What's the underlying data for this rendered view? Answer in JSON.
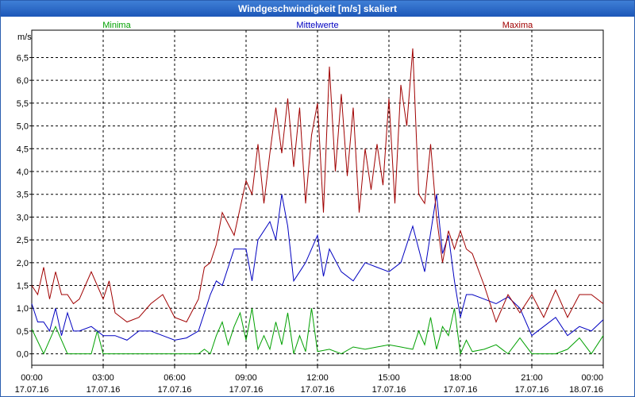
{
  "window": {
    "title": "Windgeschwindigkeit [m/s] skaliert"
  },
  "chart_data": {
    "type": "line",
    "title": "Windgeschwindigkeit [m/s] skaliert",
    "ylabel": "m/s",
    "xlabel": "",
    "ylim": [
      -0.25,
      7.1
    ],
    "y_ticks": [
      "0,0",
      "0,5",
      "1,0",
      "1,5",
      "2,0",
      "2,5",
      "3,0",
      "3,5",
      "4,0",
      "4,5",
      "5,0",
      "5,5",
      "6,0",
      "6,5"
    ],
    "y_tick_values": [
      0,
      0.5,
      1,
      1.5,
      2,
      2.5,
      3,
      3.5,
      4,
      4.5,
      5,
      5.5,
      6,
      6.5
    ],
    "x_ticks": [
      {
        "time": "00:00",
        "date": "17.07.16"
      },
      {
        "time": "03:00",
        "date": "17.07.16"
      },
      {
        "time": "06:00",
        "date": "17.07.16"
      },
      {
        "time": "09:00",
        "date": "17.07.16"
      },
      {
        "time": "12:00",
        "date": "17.07.16"
      },
      {
        "time": "15:00",
        "date": "17.07.16"
      },
      {
        "time": "18:00",
        "date": "17.07.16"
      },
      {
        "time": "21:00",
        "date": "17.07.16"
      },
      {
        "time": "00:00",
        "date": "18.07.16"
      }
    ],
    "x_tick_hours": [
      0,
      3,
      6,
      9,
      12,
      15,
      18,
      21,
      24
    ],
    "xlim_hours": [
      0,
      24
    ],
    "grid": true,
    "series": [
      {
        "name": "Minima",
        "color": "#00a000",
        "x_hours": [
          0,
          0.5,
          1,
          1.5,
          2,
          2.5,
          2.75,
          3,
          3.5,
          4,
          4.5,
          5,
          5.5,
          6,
          6.5,
          7,
          7.25,
          7.5,
          7.75,
          8,
          8.25,
          8.5,
          8.75,
          9,
          9.25,
          9.5,
          9.75,
          10,
          10.25,
          10.5,
          10.75,
          11,
          11.25,
          11.5,
          11.75,
          12,
          12.5,
          13,
          13.5,
          14,
          14.5,
          15,
          15.5,
          16,
          16.25,
          16.5,
          16.75,
          17,
          17.25,
          17.5,
          17.75,
          18,
          18.25,
          18.5,
          19,
          19.5,
          20,
          20.5,
          21,
          21.5,
          22,
          22.5,
          23,
          23.5,
          24
        ],
        "values": [
          0.55,
          0.0,
          0.6,
          0.0,
          0.0,
          0.0,
          0.5,
          0.0,
          0.0,
          0.0,
          0.0,
          0.0,
          0.0,
          0.0,
          0.0,
          0.0,
          0.1,
          0.0,
          0.4,
          0.7,
          0.2,
          0.6,
          0.9,
          0.3,
          1.0,
          0.1,
          0.4,
          0.1,
          0.7,
          0.2,
          0.9,
          0.0,
          0.4,
          0.05,
          1.0,
          0.05,
          0.1,
          0.0,
          0.15,
          0.1,
          0.15,
          0.2,
          0.15,
          0.1,
          0.5,
          0.2,
          0.8,
          0.1,
          0.6,
          0.4,
          1.0,
          0.0,
          0.3,
          0.05,
          0.1,
          0.2,
          0.0,
          0.35,
          0.0,
          0.0,
          0.0,
          0.1,
          0.35,
          0.0,
          0.4
        ]
      },
      {
        "name": "Mittelwerte",
        "color": "#0000c0",
        "x_hours": [
          0,
          0.25,
          0.5,
          0.75,
          1,
          1.25,
          1.5,
          1.75,
          2,
          2.5,
          3,
          3.5,
          4,
          4.5,
          5,
          5.5,
          6,
          6.5,
          7,
          7.25,
          7.5,
          7.75,
          8,
          8.5,
          9,
          9.25,
          9.5,
          10,
          10.25,
          10.5,
          10.75,
          11,
          11.5,
          12,
          12.25,
          12.5,
          13,
          13.5,
          14,
          14.5,
          15,
          15.5,
          16,
          16.5,
          17,
          17.25,
          17.5,
          17.75,
          18,
          18.25,
          18.5,
          19,
          19.5,
          20,
          20.5,
          21,
          21.5,
          22,
          22.5,
          23,
          23.5,
          24
        ],
        "values": [
          1.1,
          0.7,
          0.7,
          0.5,
          1.0,
          0.4,
          0.9,
          0.5,
          0.5,
          0.6,
          0.4,
          0.4,
          0.3,
          0.5,
          0.5,
          0.4,
          0.3,
          0.35,
          0.5,
          0.9,
          1.3,
          1.6,
          1.5,
          2.3,
          2.3,
          1.6,
          2.5,
          2.9,
          2.5,
          3.5,
          2.8,
          1.6,
          2.0,
          2.6,
          1.7,
          2.3,
          1.8,
          1.6,
          2.0,
          1.9,
          1.8,
          2.0,
          2.8,
          1.8,
          3.5,
          2.2,
          2.6,
          1.6,
          0.8,
          1.3,
          1.3,
          1.2,
          1.1,
          1.25,
          1.0,
          0.4,
          0.6,
          0.8,
          0.4,
          0.6,
          0.5,
          0.75
        ]
      },
      {
        "name": "Maxima",
        "color": "#a00000",
        "x_hours": [
          0,
          0.25,
          0.5,
          0.75,
          1,
          1.25,
          1.5,
          1.75,
          2,
          2.5,
          3,
          3.25,
          3.5,
          4,
          4.5,
          5,
          5.5,
          6,
          6.5,
          7,
          7.25,
          7.5,
          7.75,
          8,
          8.5,
          9,
          9.25,
          9.5,
          9.75,
          10,
          10.25,
          10.5,
          10.75,
          11,
          11.25,
          11.5,
          11.75,
          12,
          12.25,
          12.5,
          12.75,
          13,
          13.25,
          13.5,
          13.75,
          14,
          14.25,
          14.5,
          14.75,
          15,
          15.25,
          15.5,
          15.75,
          16,
          16.25,
          16.5,
          16.75,
          17,
          17.25,
          17.5,
          17.75,
          18,
          18.25,
          18.5,
          19,
          19.5,
          20,
          20.5,
          21,
          21.5,
          22,
          22.5,
          23,
          23.5,
          24
        ],
        "values": [
          1.5,
          1.3,
          1.9,
          1.2,
          1.8,
          1.3,
          1.3,
          1.1,
          1.2,
          1.8,
          1.2,
          1.6,
          0.9,
          0.7,
          0.8,
          1.1,
          1.3,
          0.8,
          0.7,
          1.2,
          1.9,
          2.0,
          2.4,
          3.1,
          2.6,
          3.8,
          3.5,
          4.6,
          3.3,
          4.4,
          5.4,
          4.4,
          5.6,
          4.1,
          5.4,
          3.3,
          4.8,
          5.5,
          3.1,
          6.3,
          4.0,
          5.7,
          3.9,
          5.4,
          3.1,
          4.5,
          3.6,
          4.6,
          3.7,
          5.6,
          3.3,
          5.9,
          5.0,
          6.7,
          3.5,
          3.3,
          4.6,
          3.0,
          2.0,
          2.7,
          2.3,
          2.7,
          2.3,
          2.2,
          1.5,
          0.7,
          1.3,
          0.9,
          1.3,
          0.8,
          1.4,
          0.8,
          1.3,
          1.3,
          1.1
        ]
      }
    ]
  }
}
